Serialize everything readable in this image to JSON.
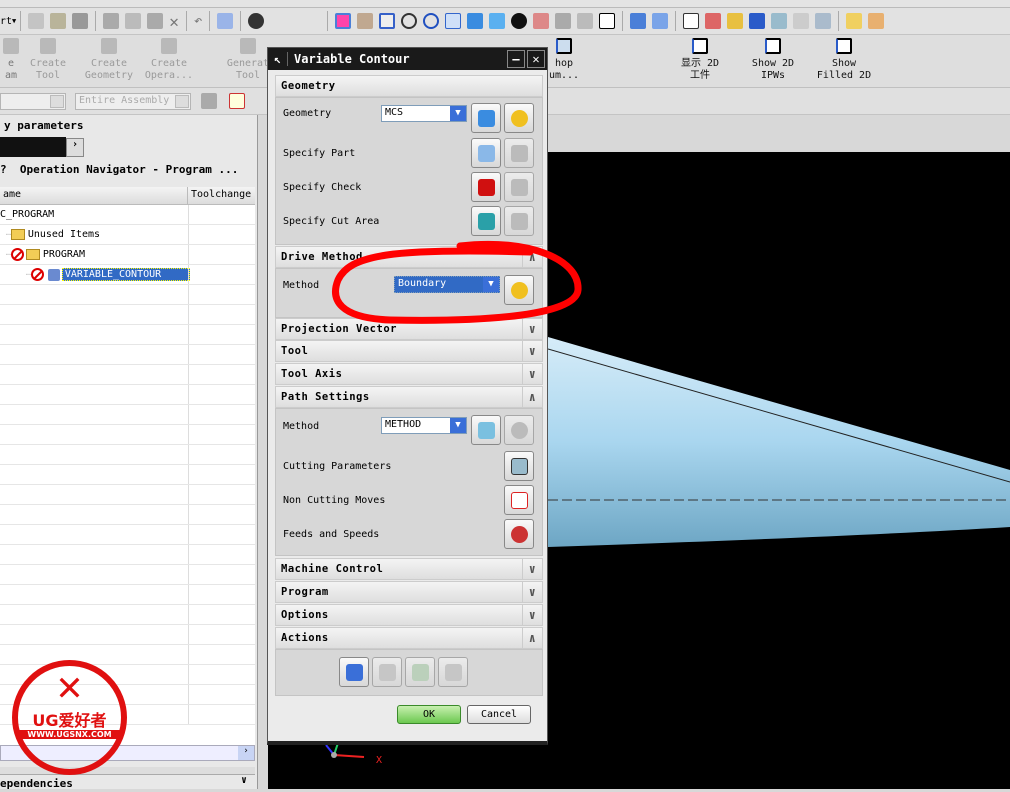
{
  "toolbar": {
    "start_label": "rt",
    "items": [
      "new-icon",
      "open-icon",
      "save-icon",
      "cut-icon",
      "copy-icon",
      "paste-icon",
      "delete-icon",
      "undo-icon",
      "information-icon",
      "binoculars-icon"
    ]
  },
  "view_toolbar": {
    "items": [
      "fit-icon",
      "zoom-window-icon",
      "zoom-area-icon",
      "zoom-icon",
      "rotate-icon",
      "pan-icon",
      "box-icon",
      "shaded-icon",
      "wireframe-icon",
      "solid-icon",
      "plane-icon",
      "background-icon",
      "csys-icon",
      "csys-2-icon",
      "snap-icon",
      "select-icon",
      "palette-icon",
      "play-icon",
      "swap-icon",
      "cursor-icon",
      "swap-2-icon",
      "measure-icon",
      "angle-icon"
    ]
  },
  "cam_toolbar": {
    "buttons": [
      {
        "label": "e\nam"
      },
      {
        "label": "Create\nTool"
      },
      {
        "label": "Create\nGeometry"
      },
      {
        "label": "Create\nOpera..."
      },
      {
        "label": "Generat\nTool"
      },
      {
        "label": "hop\num..."
      },
      {
        "label": "显示 2D\n工件"
      },
      {
        "label": "Show 2D\nIPWs"
      },
      {
        "label": "Show\nFilled 2D"
      }
    ]
  },
  "selection_bar": {
    "filter_value": "",
    "scope_value": "Entire Assembly"
  },
  "left_panel": {
    "title": "y parameters",
    "navigator_title": "Operation Navigator - Program ...",
    "columns": [
      "ame",
      "Toolchange"
    ],
    "rows": [
      {
        "name": "C_PROGRAM",
        "level": 0
      },
      {
        "name": "Unused Items",
        "level": 1,
        "folder": true
      },
      {
        "name": "PROGRAM",
        "level": 1,
        "folder": true,
        "blocked": true
      },
      {
        "name": "VARIABLE_CONTOUR",
        "level": 2,
        "blocked": true,
        "selected": true
      }
    ],
    "dependencies_label": "ependencies"
  },
  "dialog": {
    "title": "Variable Contour",
    "geometry": {
      "header": "Geometry",
      "geometry_label": "Geometry",
      "geometry_value": "MCS",
      "specify_part": "Specify Part",
      "specify_check": "Specify Check",
      "specify_cut_area": "Specify Cut Area"
    },
    "drive_method": {
      "header": "Drive Method",
      "method_label": "Method",
      "method_value": "Boundary"
    },
    "collapsed": [
      "Projection Vector",
      "Tool",
      "Tool Axis"
    ],
    "path_settings": {
      "header": "Path Settings",
      "method_label": "Method",
      "method_value": "METHOD",
      "cutting_parameters": "Cutting Parameters",
      "non_cutting_moves": "Non Cutting Moves",
      "feeds_and_speeds": "Feeds and Speeds"
    },
    "collapsed2": [
      "Machine Control",
      "Program",
      "Options"
    ],
    "actions": {
      "header": "Actions",
      "buttons": [
        "generate-icon",
        "replay-icon",
        "verify-icon",
        "list-icon"
      ]
    },
    "ok_label": "OK",
    "cancel_label": "Cancel"
  },
  "viewport": {
    "axis_label": "X",
    "part_color": "#a8d4ec",
    "annotation_color": "#ff0000"
  },
  "watermark": {
    "text": "UG爱好者",
    "url": "WWW.UGSNX.COM"
  }
}
